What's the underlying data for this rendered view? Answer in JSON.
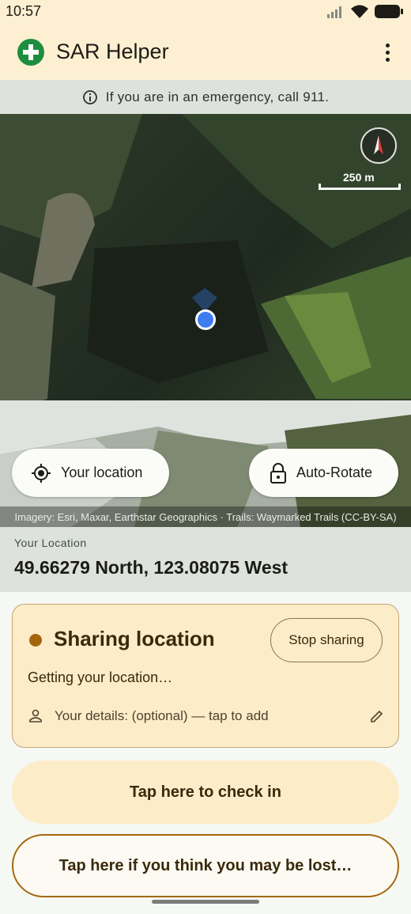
{
  "status_bar": {
    "time": "10:57"
  },
  "app": {
    "title": "SAR Helper"
  },
  "banner": {
    "text": "If you are in an emergency, call 911."
  },
  "map": {
    "scale_label": "250 m",
    "attribution": "Imagery: Esri, Maxar, Earthstar Geographics · Trails: Waymarked Trails (CC-BY-SA)",
    "your_location_label": "Your location",
    "auto_rotate_label": "Auto-Rotate"
  },
  "coordinates": {
    "label": "Your Location",
    "value": "49.66279 North, 123.08075 West"
  },
  "sharing": {
    "title": "Sharing location",
    "stop_label": "Stop sharing",
    "status": "Getting your location…",
    "details": "Your details: (optional) — tap to add"
  },
  "actions": {
    "check_in": "Tap here to check in",
    "lost": "Tap here if you think you may be lost…"
  },
  "colors": {
    "app_bar": "#fdf0d2",
    "brand_green": "#1e8e3e",
    "location_blue": "#3d7df0",
    "sharing_accent": "#a5660b",
    "card_background": "#fdecc8"
  },
  "icons": [
    "info-icon",
    "compass-icon",
    "my-location-icon",
    "lock-icon",
    "person-icon",
    "edit-icon",
    "more-vert-icon"
  ]
}
